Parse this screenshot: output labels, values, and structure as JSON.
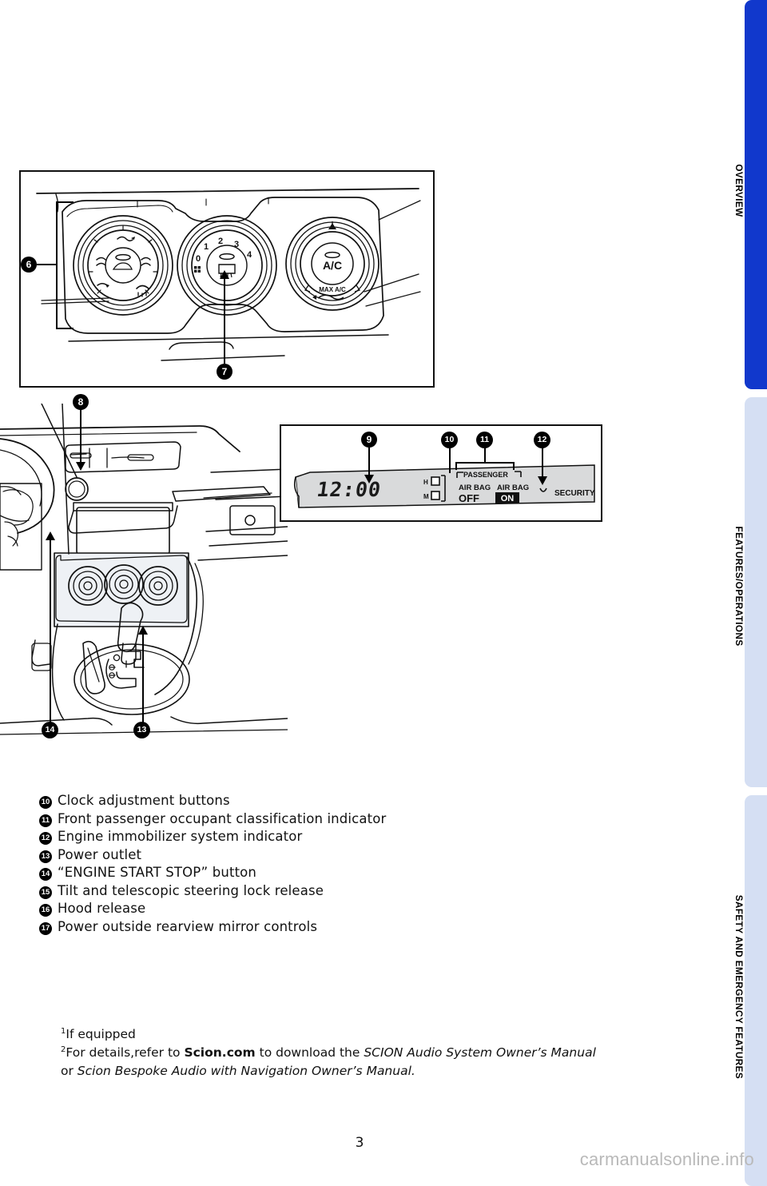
{
  "page": {
    "number": "3",
    "watermark": "carmanualsonline.info"
  },
  "side_tabs": [
    {
      "label": "OVERVIEW",
      "state": "active",
      "color": "#1138cc"
    },
    {
      "label": "FEATURES/OPERATIONS",
      "state": "inactive",
      "color": "#d5dff3"
    },
    {
      "label": "SAFETY AND EMERGENCY FEATURES",
      "state": "inactive",
      "color": "#d5dff3"
    }
  ],
  "figures": {
    "climate_panel": {
      "callouts": [
        {
          "id": "6",
          "target": "climate-control-dials-group"
        },
        {
          "id": "7",
          "target": "fan-speed-dial"
        }
      ],
      "dials": {
        "airflow_mode": {
          "name": "airflow-mode-dial"
        },
        "fan_speed": {
          "name": "fan-speed-dial",
          "positions": [
            "0",
            "1",
            "2",
            "3",
            "4"
          ]
        },
        "temperature": {
          "name": "temperature-dial",
          "ac_label": "A/C",
          "max_ac_label": "MAX A/C"
        }
      }
    },
    "interior_view": {
      "callouts": [
        {
          "id": "8",
          "target": "engine-start-stop-button"
        },
        {
          "id": "13",
          "target": "power-outlet"
        },
        {
          "id": "14",
          "target": "engine-start-stop-button"
        }
      ]
    },
    "display_panel": {
      "callouts": [
        {
          "id": "9",
          "target": "clock-display"
        },
        {
          "id": "10",
          "target": "clock-adjustment-buttons"
        },
        {
          "id": "11",
          "target": "passenger-airbag-indicator"
        },
        {
          "id": "12",
          "target": "security-indicator"
        }
      ],
      "clock_value": "12:00",
      "hour_button_label": "H",
      "minute_button_label": "M",
      "passenger_header": "PASSENGER",
      "airbag_off_line1": "AIR BAG",
      "airbag_off_line2": "OFF",
      "airbag_on_line1": "AIR BAG",
      "airbag_on_line2": "ON",
      "security_label": "SECURITY"
    }
  },
  "items": [
    {
      "num": "10",
      "label": "Clock adjustment buttons"
    },
    {
      "num": "11",
      "label": "Front passenger occupant classification indicator"
    },
    {
      "num": "12",
      "label": "Engine immobilizer system indicator"
    },
    {
      "num": "13",
      "label": "Power outlet"
    },
    {
      "num": "14",
      "label": "“ENGINE START STOP” button"
    },
    {
      "num": "15",
      "label": "Tilt and telescopic steering lock release"
    },
    {
      "num": "16",
      "label": "Hood release"
    },
    {
      "num": "17",
      "label": "Power outside rearview mirror controls"
    }
  ],
  "footnotes": {
    "one_marker": "1",
    "one_text": "If equipped",
    "two_marker": "2",
    "two_part1": "For details,",
    "two_part2": "refer to ",
    "two_bold": "Scion.com",
    "two_part3": " to download the ",
    "two_italic1": "SCION Audio System Owner’s Manual",
    "two_part4": "or ",
    "two_italic2": "Scion Bespoke Audio with Navigation Owner’s Manual."
  }
}
